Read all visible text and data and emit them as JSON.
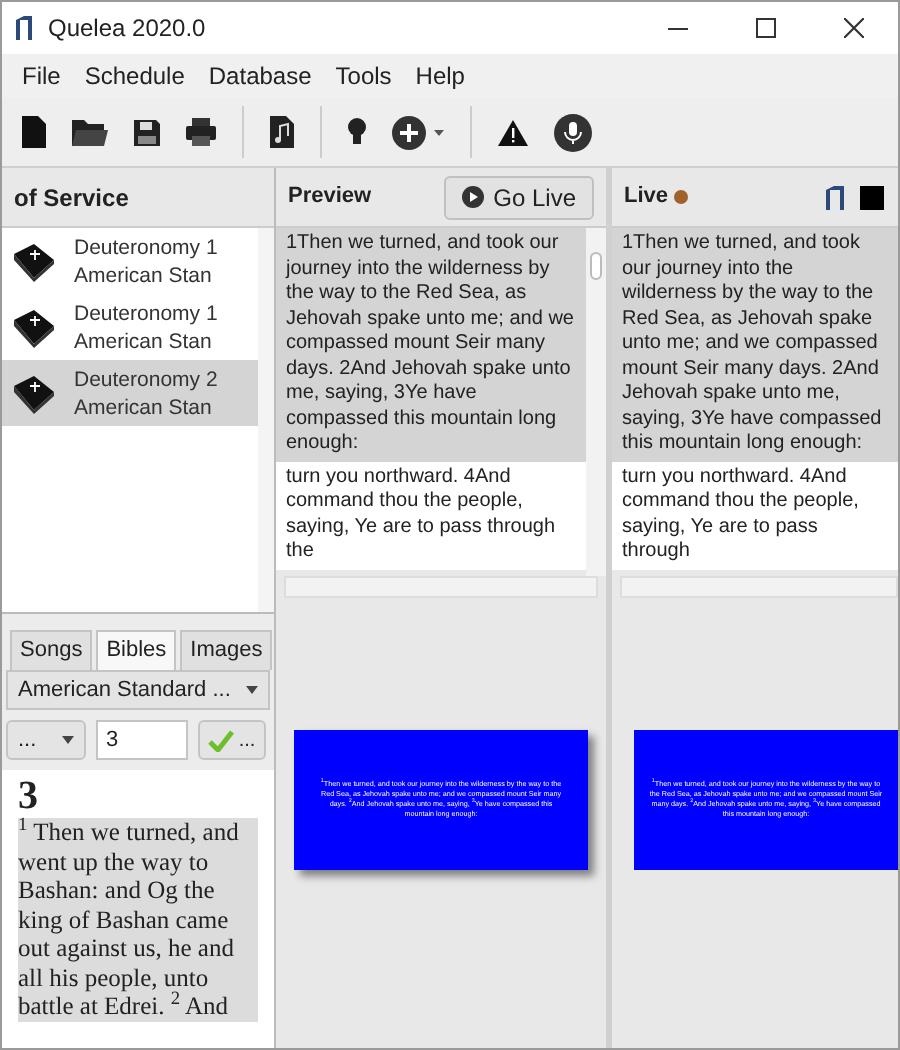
{
  "window": {
    "title": "Quelea 2020.0"
  },
  "menu": [
    "File",
    "Schedule",
    "Database",
    "Tools",
    "Help"
  ],
  "schedule": {
    "title": "of Service",
    "items": [
      {
        "title": "Deuteronomy 1",
        "subtitle": "American Stan",
        "selected": false
      },
      {
        "title": "Deuteronomy 1",
        "subtitle": "American Stan",
        "selected": false
      },
      {
        "title": "Deuteronomy 2",
        "subtitle": "American Stan",
        "selected": true
      }
    ]
  },
  "library": {
    "tabs": [
      {
        "label": "Songs",
        "selected": false
      },
      {
        "label": "Bibles",
        "selected": true
      },
      {
        "label": "Images",
        "selected": false
      }
    ],
    "bible_dropdown": "American Standard ...",
    "book_dropdown": "...",
    "chapter_value": "3",
    "go_button": "...",
    "chapter_heading": "3",
    "passage": "$^{1}$ Then we turned, and went up the way to Bashan: and Og the king of Bashan came out against us, he and all his people, unto battle at Edrei. $^{2}$ And"
  },
  "preview": {
    "title": "Preview",
    "go_live_button": "Go Live",
    "slides": [
      {
        "text": "1Then we turned, and took our journey into the wilderness by the way to the Red Sea, as Jehovah spake unto me; and we compassed mount Seir many days. 2And Jehovah spake unto me, saying, 3Ye have compassed this mountain long enough:",
        "selected": true
      },
      {
        "text": "turn you northward. 4And command thou the people, saying, Ye are to pass through the",
        "selected": false
      }
    ],
    "thumbnail_text": "$^{1}$Then we turned, and took our journey into the wilderness by the way to the Red Sea, as Jehovah spake unto me; and we compassed mount Seir many days. $^{2}$And Jehovah spake unto me, saying, $^{3}$Ye have compassed this mountain long enough:"
  },
  "live": {
    "title": "Live",
    "slides": [
      {
        "text": "1Then we turned, and took our journey into the wilderness by the way to the Red Sea, as Jehovah spake unto me; and we compassed mount Seir many days. 2And Jehovah spake unto me, saying, 3Ye have compassed this mountain long enough:",
        "selected": true
      },
      {
        "text": "turn you northward. 4And command thou the people, saying, Ye are to pass through",
        "selected": false
      }
    ],
    "thumbnail_text": "$^{1}$Then we turned, and took our journey into the wilderness by the way to the Red Sea, as Jehovah spake unto me; and we compassed mount Seir many days. $^{2}$And Jehovah spake unto me, saying, $^{3}$Ye have compassed this mountain long enough:"
  }
}
